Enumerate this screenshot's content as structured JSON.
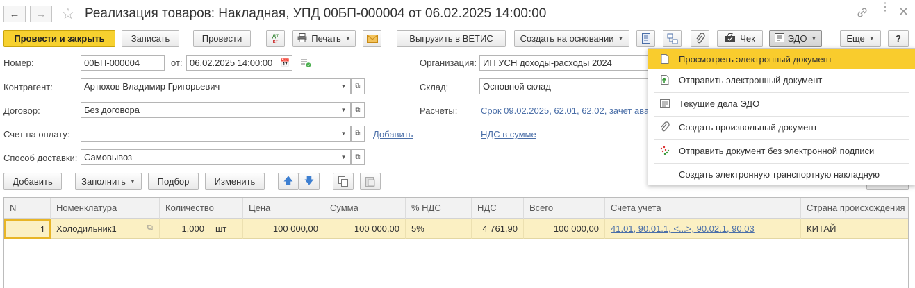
{
  "window": {
    "title": "Реализация товаров: Накладная, УПД 00БП-000004 от 06.02.2025 14:00:00"
  },
  "toolbar": {
    "post_close": "Провести и закрыть",
    "save": "Записать",
    "post": "Провести",
    "dtkt_top": "дт",
    "dtkt_bottom": "кт",
    "print": "Печать",
    "vetis": "Выгрузить в ВЕТИС",
    "create_based": "Создать на основании",
    "check": "Чек",
    "edo": "ЭДО",
    "more": "Еще",
    "help": "?"
  },
  "form": {
    "number_label": "Номер:",
    "number_value": "00БП-000004",
    "from_label": "от:",
    "date_value": "06.02.2025 14:00:00",
    "org_label": "Организация:",
    "org_value": "ИП УСН доходы-расходы 2024",
    "counterparty_label": "Контрагент:",
    "counterparty_value": "Артюхов Владимир Григорьевич",
    "warehouse_label": "Склад:",
    "warehouse_value": "Основной склад",
    "contract_label": "Договор:",
    "contract_value": "Без договора",
    "settlements_label": "Расчеты:",
    "settlements_link": "Срок 09.02.2025, 62.01, 62.02, зачет ава",
    "invoice_label": "Счет на оплату:",
    "invoice_value": "",
    "add_link": "Добавить",
    "vat_link": "НДС в сумме",
    "delivery_label": "Способ доставки:",
    "delivery_value": "Самовывоз"
  },
  "table_toolbar": {
    "add": "Добавить",
    "fill": "Заполнить",
    "select": "Подбор",
    "change": "Изменить"
  },
  "table": {
    "headers": [
      "N",
      "Номенклатура",
      "Количество",
      "Цена",
      "Сумма",
      "% НДС",
      "НДС",
      "Всего",
      "Счета учета",
      "Страна происхождения"
    ],
    "rows": [
      {
        "n": "1",
        "item": "Холодильник1",
        "qty": "1,000",
        "unit": "шт",
        "price": "100 000,00",
        "sum": "100 000,00",
        "vat_rate": "5%",
        "vat": "4 761,90",
        "total": "100 000,00",
        "accounts": "41.01, 90.01.1, <...>, 90.02.1, 90.03",
        "country": "КИТАЙ"
      }
    ]
  },
  "edo_menu": {
    "items": [
      {
        "label": "Просмотреть электронный документ",
        "icon": "document-icon"
      },
      {
        "label": "Отправить электронный документ",
        "icon": "send-document-icon"
      },
      {
        "label": "Текущие дела ЭДО",
        "icon": "list-icon"
      },
      {
        "label": "Создать произвольный документ",
        "icon": "paperclip-icon"
      },
      {
        "label": "Отправить документ без электронной подписи",
        "icon": "dots-icon"
      },
      {
        "label": "Создать электронную транспортную накладную",
        "icon": ""
      }
    ]
  },
  "colors": {
    "primary": "#f7d12f",
    "highlight": "#f9cc2d",
    "row_selected": "#fbf0c3",
    "link": "#4b6fa8"
  }
}
